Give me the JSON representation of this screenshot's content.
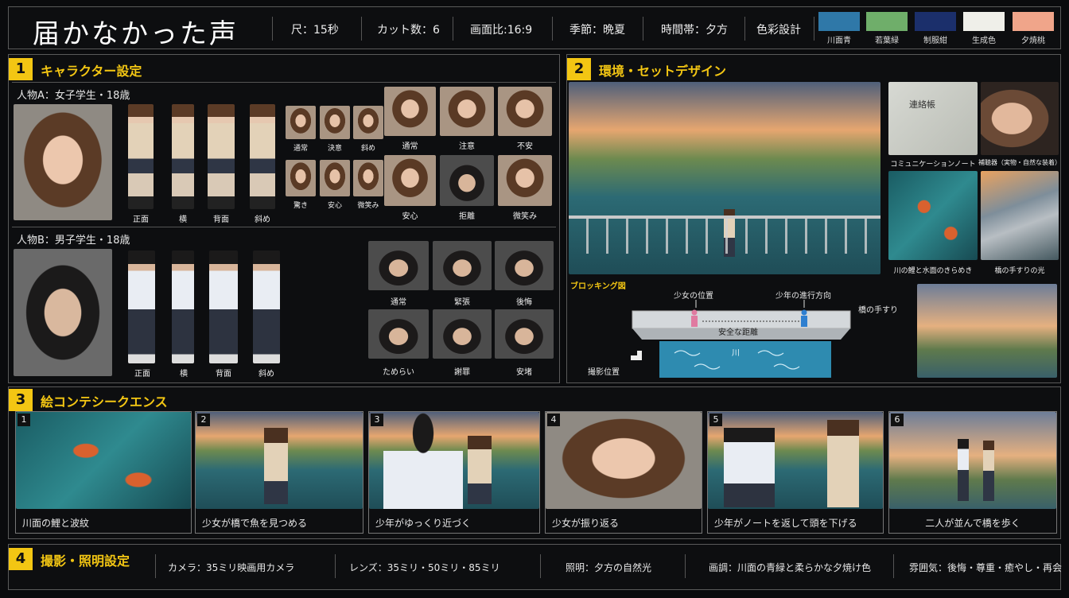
{
  "header": {
    "title": "届かなかった声",
    "duration": "尺：15秒",
    "cuts": "カット数：6",
    "aspect": "画面比:16:9",
    "season": "季節：晩夏",
    "time_of_day": "時間帯：夕方",
    "color_design_label": "色彩設計",
    "swatches": [
      {
        "label": "川面青",
        "color": "#2f78a8"
      },
      {
        "label": "若葉緑",
        "color": "#6fae6a"
      },
      {
        "label": "制服紺",
        "color": "#1b2f6b"
      },
      {
        "label": "生成色",
        "color": "#efefe9"
      },
      {
        "label": "夕焼桃",
        "color": "#f0a58a"
      }
    ]
  },
  "sections": {
    "s1": {
      "num": "1",
      "title": "キャラクター設定"
    },
    "s2": {
      "num": "2",
      "title": "環境・セットデザイン"
    },
    "s3": {
      "num": "3",
      "title": "絵コンテシークエンス"
    },
    "s4": {
      "num": "4",
      "title": "撮影・照明設定"
    }
  },
  "characters": {
    "a": {
      "label": "人物A：女子学生・18歳",
      "turnaround": [
        "正面",
        "横",
        "背面",
        "斜め"
      ],
      "small_expressions": [
        "通常",
        "決意",
        "斜め",
        "驚き",
        "安心",
        "微笑み"
      ],
      "large_expressions": [
        "通常",
        "注意",
        "不安",
        "安心",
        "拒離",
        "微笑み"
      ]
    },
    "b": {
      "label": "人物B：男子学生・18歳",
      "turnaround": [
        "正面",
        "横",
        "背面",
        "斜め"
      ],
      "expressions": [
        "通常",
        "緊張",
        "後悔",
        "ためらい",
        "謝罪",
        "安堵"
      ]
    }
  },
  "environment": {
    "props": [
      "コミュニケーションノート",
      "補聴器（実物・自然な装着）",
      "川の鯉と水面のきらめき",
      "橋の手すりの光"
    ],
    "note_cover": "連絡帳",
    "blocking": {
      "label": "ブロッキング図",
      "girl_pos": "少女の位置",
      "boy_dir": "少年の進行方向",
      "handrail": "橋の手すり",
      "distance": "安全な距離",
      "river": "川",
      "camera": "撮影位置"
    }
  },
  "storyboard": [
    {
      "num": "1",
      "caption": "川面の鯉と波紋"
    },
    {
      "num": "2",
      "caption": "少女が橋で魚を見つめる"
    },
    {
      "num": "3",
      "caption": "少年がゆっくり近づく"
    },
    {
      "num": "4",
      "caption": "少女が振り返る"
    },
    {
      "num": "5",
      "caption": "少年がノートを返して頭を下げる"
    },
    {
      "num": "6",
      "caption": "二人が並んで橋を歩く"
    }
  ],
  "camera_settings": {
    "camera": "カメラ：35ミリ映画用カメラ",
    "lens": "レンズ：35ミリ・50ミリ・85ミリ",
    "lighting": "照明：夕方の自然光",
    "tone": "画調：川面の青緑と柔らかな夕焼け色",
    "mood": "雰囲気：後悔・尊重・癒やし・再会"
  }
}
